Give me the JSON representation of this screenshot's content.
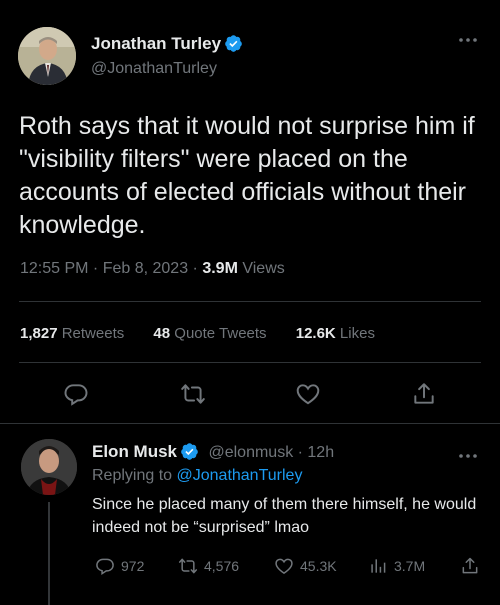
{
  "main_tweet": {
    "author_name": "Jonathan Turley",
    "author_handle": "@JonathanTurley",
    "text": "Roth says that it would not surprise him if \"visibility filters\" were placed on the accounts of elected officials without their knowledge.",
    "time": "12:55 PM · Feb 8, 2023 · ",
    "views_count": "3.9M",
    "views_label": " Views",
    "retweets_count": "1,827",
    "retweets_label": " Retweets",
    "quotes_count": "48",
    "quotes_label": " Quote Tweets",
    "likes_count": "12.6K",
    "likes_label": " Likes"
  },
  "reply": {
    "author_name": "Elon Musk",
    "author_handle": "@elonmusk",
    "sep": " · ",
    "time": "12h",
    "replying_prefix": "Replying to ",
    "replying_to": "@JonathanTurley",
    "text": "Since he placed many of them there himself, he would indeed not be “surprised” lmao",
    "replies": "972",
    "retweets": "4,576",
    "likes": "45.3K",
    "views": "3.7M"
  },
  "colors": {
    "background": "#000000",
    "text": "#e7e9ea",
    "muted": "#71767b",
    "accent": "#1d9bf0",
    "divider": "#2f3336"
  },
  "icons": [
    "verified-badge-icon",
    "more-icon",
    "reply-icon",
    "retweet-icon",
    "like-icon",
    "share-icon",
    "views-icon"
  ]
}
